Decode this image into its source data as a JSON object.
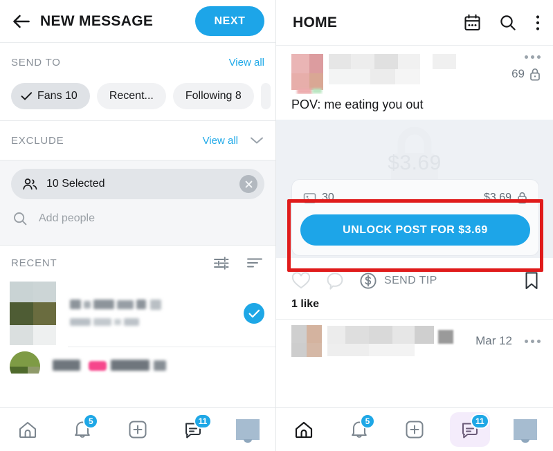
{
  "left_panel": {
    "header": {
      "back_icon": "back-arrow-icon",
      "title": "NEW MESSAGE",
      "next_label": "NEXT"
    },
    "send_to": {
      "label": "SEND TO",
      "view_all": "View all",
      "chips": [
        {
          "label": "Fans 10",
          "selected": true
        },
        {
          "label": "Recent...",
          "selected": false
        },
        {
          "label": "Following 8",
          "selected": false
        }
      ]
    },
    "exclude": {
      "label": "EXCLUDE",
      "view_all": "View all",
      "chevron_icon": "chevron-down-icon",
      "selected_pill": {
        "people_icon": "people-icon",
        "text": "10 Selected",
        "clear_icon": "close-circle-icon"
      },
      "search": {
        "icon": "search-icon",
        "placeholder": "Add people"
      }
    },
    "recent": {
      "label": "RECENT",
      "filter_icon": "tune-icon",
      "sort_icon": "sort-icon",
      "items": [
        {
          "name_redacted": true,
          "handle_redacted": true,
          "selected": true
        },
        {
          "name_redacted": true,
          "handle_redacted": true,
          "selected": false
        }
      ]
    },
    "bottom_nav": {
      "items": [
        {
          "name": "home",
          "icon": "home-icon",
          "badge": null,
          "active": false
        },
        {
          "name": "notifications",
          "icon": "bell-icon",
          "badge": "5",
          "active": false
        },
        {
          "name": "new-post",
          "icon": "plus-box-icon",
          "badge": null,
          "active": false
        },
        {
          "name": "messages",
          "icon": "chat-icon",
          "badge": "11",
          "active": false
        },
        {
          "name": "profile",
          "icon": "avatar-icon",
          "badge": null,
          "active": false
        }
      ]
    }
  },
  "right_panel": {
    "header": {
      "title": "HOME",
      "calendar_icon": "calendar-icon",
      "search_icon": "search-icon",
      "more_icon": "more-vertical-icon"
    },
    "post": {
      "author_redacted": true,
      "more_icon": "more-horizontal-icon",
      "count": "69",
      "count_lock_icon": "lock-icon",
      "caption": "POV: me eating you out",
      "locked": {
        "watermark_price": "$3.69",
        "watermark_lock_icon": "lock-icon",
        "media_icon": "image-icon",
        "media_count": "30",
        "price": "$3.69",
        "price_lock_icon": "lock-icon",
        "unlock_label": "UNLOCK POST FOR $3.69",
        "highlight_color": "#e01b1b"
      },
      "actions": {
        "like_icon": "heart-icon",
        "comment_icon": "comment-icon",
        "tip_icon": "dollar-circle-icon",
        "tip_label": "SEND TIP",
        "bookmark_icon": "bookmark-icon"
      },
      "likes": "1 like"
    },
    "next_post": {
      "author_redacted": true,
      "date": "Mar 12",
      "more_icon": "more-horizontal-icon"
    },
    "bottom_nav": {
      "items": [
        {
          "name": "home",
          "icon": "home-icon",
          "badge": null,
          "active": false
        },
        {
          "name": "notifications",
          "icon": "bell-icon",
          "badge": "5",
          "active": false
        },
        {
          "name": "new-post",
          "icon": "plus-box-icon",
          "badge": null,
          "active": false
        },
        {
          "name": "messages",
          "icon": "chat-icon",
          "badge": "11",
          "active": true
        },
        {
          "name": "profile",
          "icon": "avatar-icon",
          "badge": null,
          "active": false
        }
      ]
    }
  },
  "colors": {
    "accent_blue": "#1da5e8",
    "link_blue": "#1fa9e8",
    "highlight_red": "#e01b1b",
    "active_nav_bg": "#f4ecfb"
  }
}
